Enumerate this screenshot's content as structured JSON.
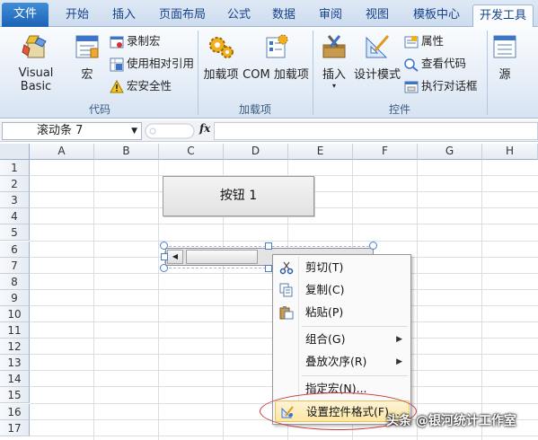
{
  "tabs": [
    "文件",
    "开始",
    "插入",
    "页面布局",
    "公式",
    "数据",
    "审阅",
    "视图",
    "模板中心",
    "开发工具"
  ],
  "active_tab": "开发工具",
  "ribbon": {
    "code": {
      "label": "代码",
      "visual_basic": "Visual Basic",
      "macros": "宏",
      "record_macro": "录制宏",
      "relative_ref": "使用相对引用",
      "macro_security": "宏安全性"
    },
    "addins": {
      "label": "加载项",
      "addins": "加载项",
      "com_addins": "COM 加载项"
    },
    "controls": {
      "label": "控件",
      "insert": "插入",
      "design_mode": "设计模式",
      "properties": "属性",
      "view_code": "查看代码",
      "run_dialog": "执行对话框"
    },
    "xml": {
      "source": "源"
    }
  },
  "formula_bar": {
    "name_box": "滚动条 7",
    "fx": "fx",
    "content": ""
  },
  "columns": [
    "A",
    "B",
    "C",
    "D",
    "E",
    "F",
    "G",
    "H"
  ],
  "rows": [
    "1",
    "2",
    "3",
    "4",
    "5",
    "6",
    "7",
    "8",
    "9",
    "10",
    "11",
    "12",
    "13",
    "14",
    "15",
    "16",
    "17"
  ],
  "form_button_label": "按钮 1",
  "context_menu": {
    "cut": "剪切(T)",
    "copy": "复制(C)",
    "paste": "粘贴(P)",
    "group": "组合(G)",
    "order": "叠放次序(R)",
    "assign_macro": "指定宏(N)...",
    "format_control": "设置控件格式(F)..."
  },
  "watermark": "头条 @银河统计工作室",
  "colors": {
    "file_tab": "#2a72c4",
    "highlight": "#fde7a5",
    "annotation": "#c8393d"
  }
}
